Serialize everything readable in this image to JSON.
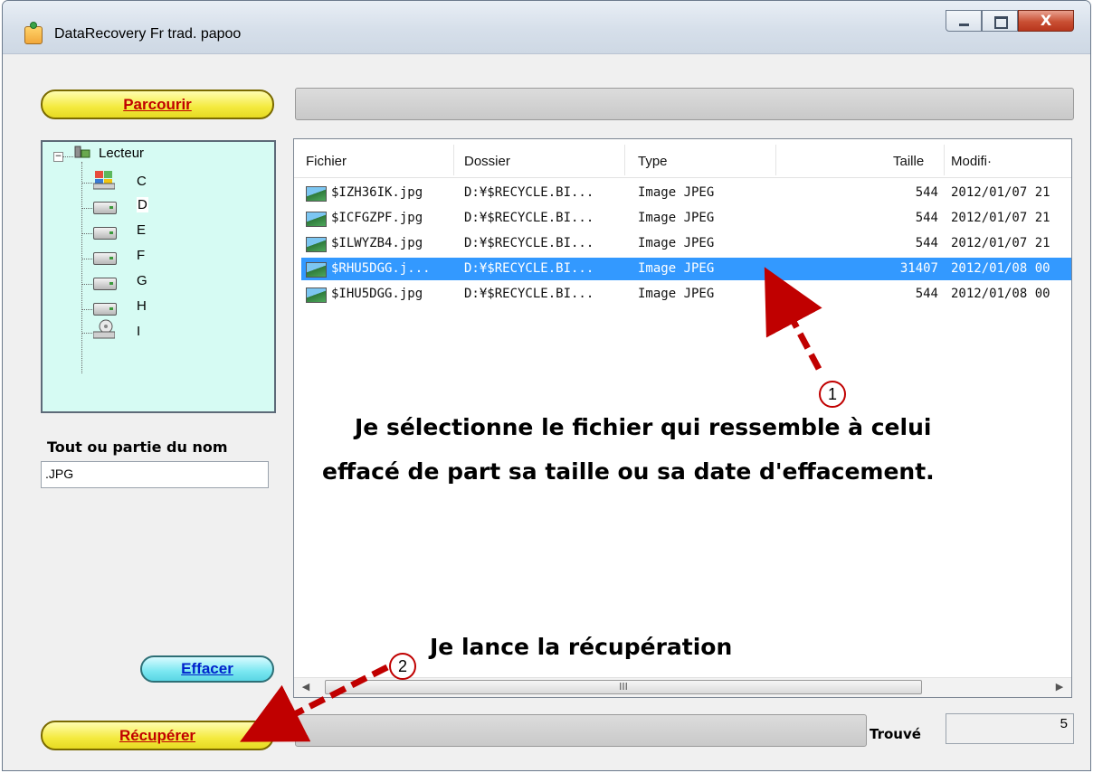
{
  "window": {
    "title": "DataRecovery Fr trad. papoo",
    "close_symbol": "X"
  },
  "buttons": {
    "browse": "Parcourir",
    "clear": "Effacer",
    "recover": "Récupérer"
  },
  "tree": {
    "root_label": "Lecteur",
    "drives": [
      "C",
      "D",
      "E",
      "F",
      "G",
      "H",
      "I"
    ]
  },
  "name_filter": {
    "label": "Tout ou partie du nom",
    "value": ".JPG"
  },
  "file_list": {
    "columns": [
      "Fichier",
      "Dossier",
      "Type",
      "Taille",
      "Modifi·"
    ],
    "rows": [
      {
        "file": "$IZH36IK.jpg",
        "folder": "D:¥$RECYCLE.BI...",
        "type": "Image JPEG",
        "size": "544",
        "modified": "2012/01/07 21"
      },
      {
        "file": "$ICFGZPF.jpg",
        "folder": "D:¥$RECYCLE.BI...",
        "type": "Image JPEG",
        "size": "544",
        "modified": "2012/01/07 21"
      },
      {
        "file": "$ILWYZB4.jpg",
        "folder": "D:¥$RECYCLE.BI...",
        "type": "Image JPEG",
        "size": "544",
        "modified": "2012/01/07 21"
      },
      {
        "file": "$RHU5DGG.j...",
        "folder": "D:¥$RECYCLE.BI...",
        "type": "Image JPEG",
        "size": "31407",
        "modified": "2012/01/08 00"
      },
      {
        "file": "$IHU5DGG.jpg",
        "folder": "D:¥$RECYCLE.BI...",
        "type": "Image JPEG",
        "size": "544",
        "modified": "2012/01/08 00"
      }
    ],
    "selected_row_number": 4,
    "scroll_grip": "III"
  },
  "status": {
    "found_label": "Trouvé",
    "found_count": "5"
  },
  "annotations": {
    "marker1": "1",
    "marker2": "2",
    "note1_line1": "Je sélectionne le fichier qui ressemble à celui",
    "note1_line2": "effacé de part sa taille ou sa date d'effacement.",
    "note2": "Je lance la récupération",
    "arrow_color": "#c00000"
  }
}
